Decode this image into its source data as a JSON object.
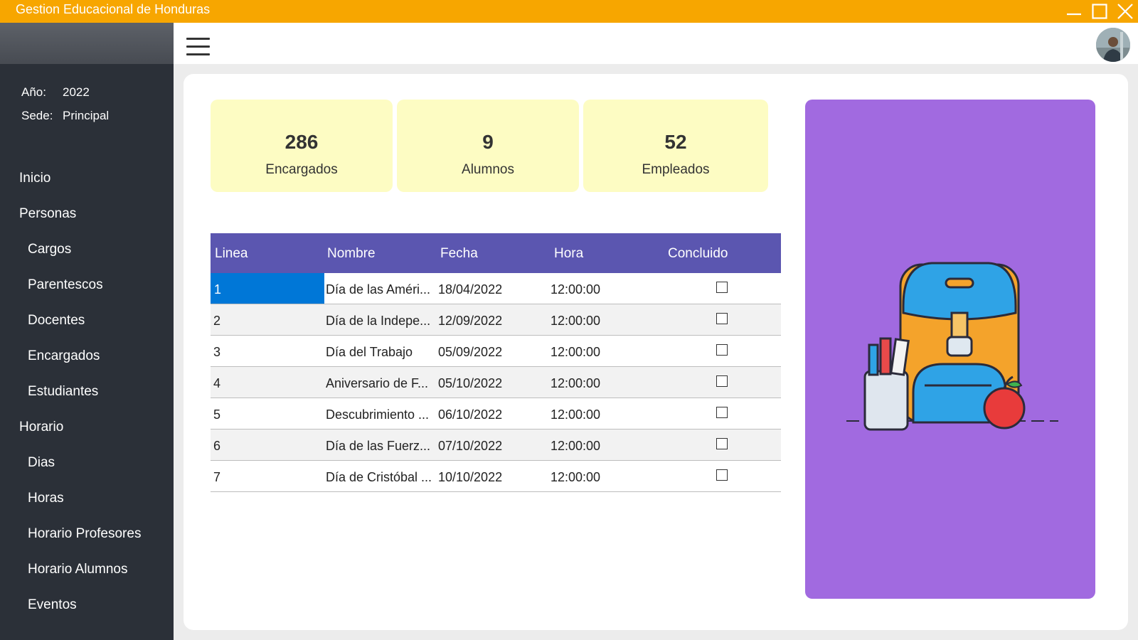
{
  "window": {
    "title": "Gestion Educacional de Honduras"
  },
  "sidebar": {
    "info": [
      {
        "label": "Año:",
        "value": "2022"
      },
      {
        "label": "Sede:",
        "value": "Principal"
      }
    ],
    "items": [
      {
        "label": "Inicio",
        "level": 0
      },
      {
        "label": "Personas",
        "level": 0
      },
      {
        "label": "Cargos",
        "level": 1
      },
      {
        "label": "Parentescos",
        "level": 1
      },
      {
        "label": "Docentes",
        "level": 1
      },
      {
        "label": "Encargados",
        "level": 1
      },
      {
        "label": "Estudiantes",
        "level": 1
      },
      {
        "label": "Horario",
        "level": 0
      },
      {
        "label": "Dias",
        "level": 1
      },
      {
        "label": "Horas",
        "level": 1
      },
      {
        "label": "Horario Profesores",
        "level": 1
      },
      {
        "label": "Horario Alumnos",
        "level": 1
      },
      {
        "label": "Eventos",
        "level": 1
      }
    ]
  },
  "stats": [
    {
      "value": "286",
      "label": "Encargados"
    },
    {
      "value": "9",
      "label": "Alumnos"
    },
    {
      "value": "52",
      "label": "Empleados"
    }
  ],
  "table": {
    "columns": [
      "Linea",
      "Nombre",
      "Fecha",
      "Hora",
      "Concluido"
    ],
    "rows": [
      {
        "linea": "1",
        "nombre": "Día de las Améri...",
        "fecha": "18/04/2022",
        "hora": "12:00:00",
        "concluido": false,
        "selected": true
      },
      {
        "linea": "2",
        "nombre": "Día de la Indepe...",
        "fecha": "12/09/2022",
        "hora": "12:00:00",
        "concluido": false
      },
      {
        "linea": "3",
        "nombre": "Día del Trabajo",
        "fecha": "05/09/2022",
        "hora": "12:00:00",
        "concluido": false
      },
      {
        "linea": "4",
        "nombre": "Aniversario de F...",
        "fecha": "05/10/2022",
        "hora": "12:00:00",
        "concluido": false
      },
      {
        "linea": "5",
        "nombre": "Descubrimiento ...",
        "fecha": "06/10/2022",
        "hora": "12:00:00",
        "concluido": false
      },
      {
        "linea": "6",
        "nombre": "Día de las Fuerz...",
        "fecha": "07/10/2022",
        "hora": "12:00:00",
        "concluido": false
      },
      {
        "linea": "7",
        "nombre": "Día de Cristóbal ...",
        "fecha": "10/10/2022",
        "hora": "12:00:00",
        "concluido": false
      }
    ]
  },
  "colors": {
    "titlebar": "#f7a600",
    "sidebar": "#2b3038",
    "table_header": "#5b56b0",
    "selection": "#0077d7",
    "stat_card": "#fdfcc3",
    "illustration_bg": "#a16ae0"
  },
  "icons": {
    "menu": "hamburger-icon",
    "minimize": "minimize-icon",
    "maximize": "maximize-icon",
    "close": "close-icon",
    "illustration": "backpack-illustration"
  }
}
